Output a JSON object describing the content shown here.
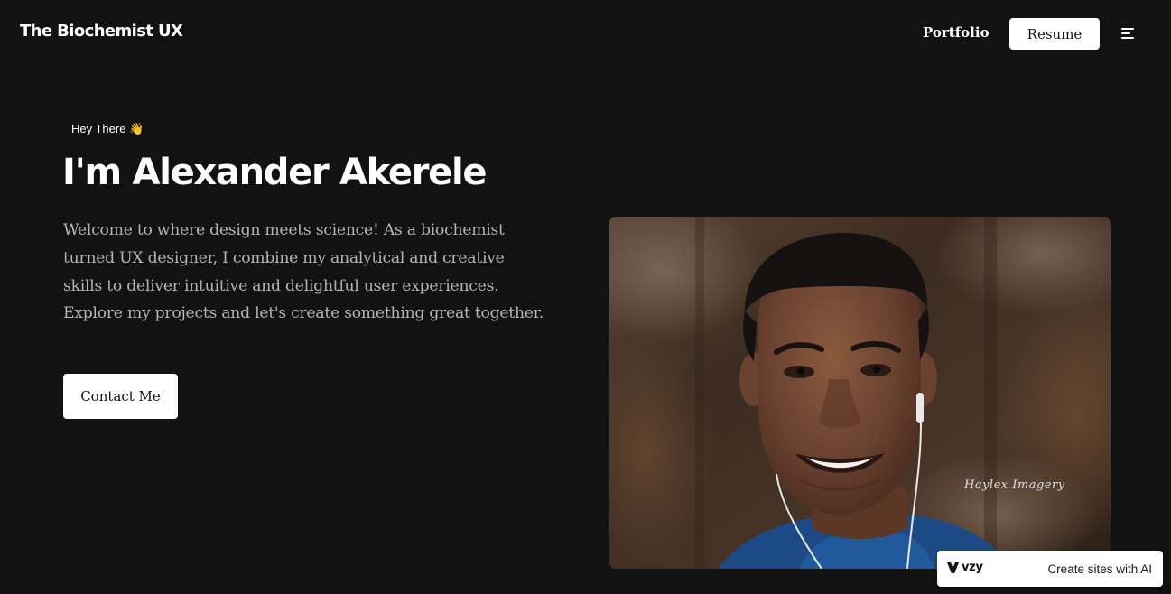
{
  "header": {
    "brand": "The Biochemist UX",
    "nav_portfolio": "Portfolio",
    "resume_label": "Resume",
    "menu_icon": "hamburger-menu-icon"
  },
  "hero": {
    "eyebrow": "Hey There 👋",
    "title": "I'm Alexander Akerele",
    "description": "Welcome to where design meets science! As a biochemist turned UX designer, I combine my analytical and creative skills to deliver intuitive and delightful user experiences. Explore my projects and let's create something great together.",
    "contact_label": "Contact Me"
  },
  "portrait": {
    "watermark": "Haylex Imagery"
  },
  "badge": {
    "logo_text": "vzy",
    "tagline": "Create sites with AI"
  },
  "colors": {
    "background": "#121212",
    "text": "#ffffff",
    "muted_text": "#b5b5b5",
    "button_bg": "#ffffff",
    "button_text": "#121212"
  }
}
